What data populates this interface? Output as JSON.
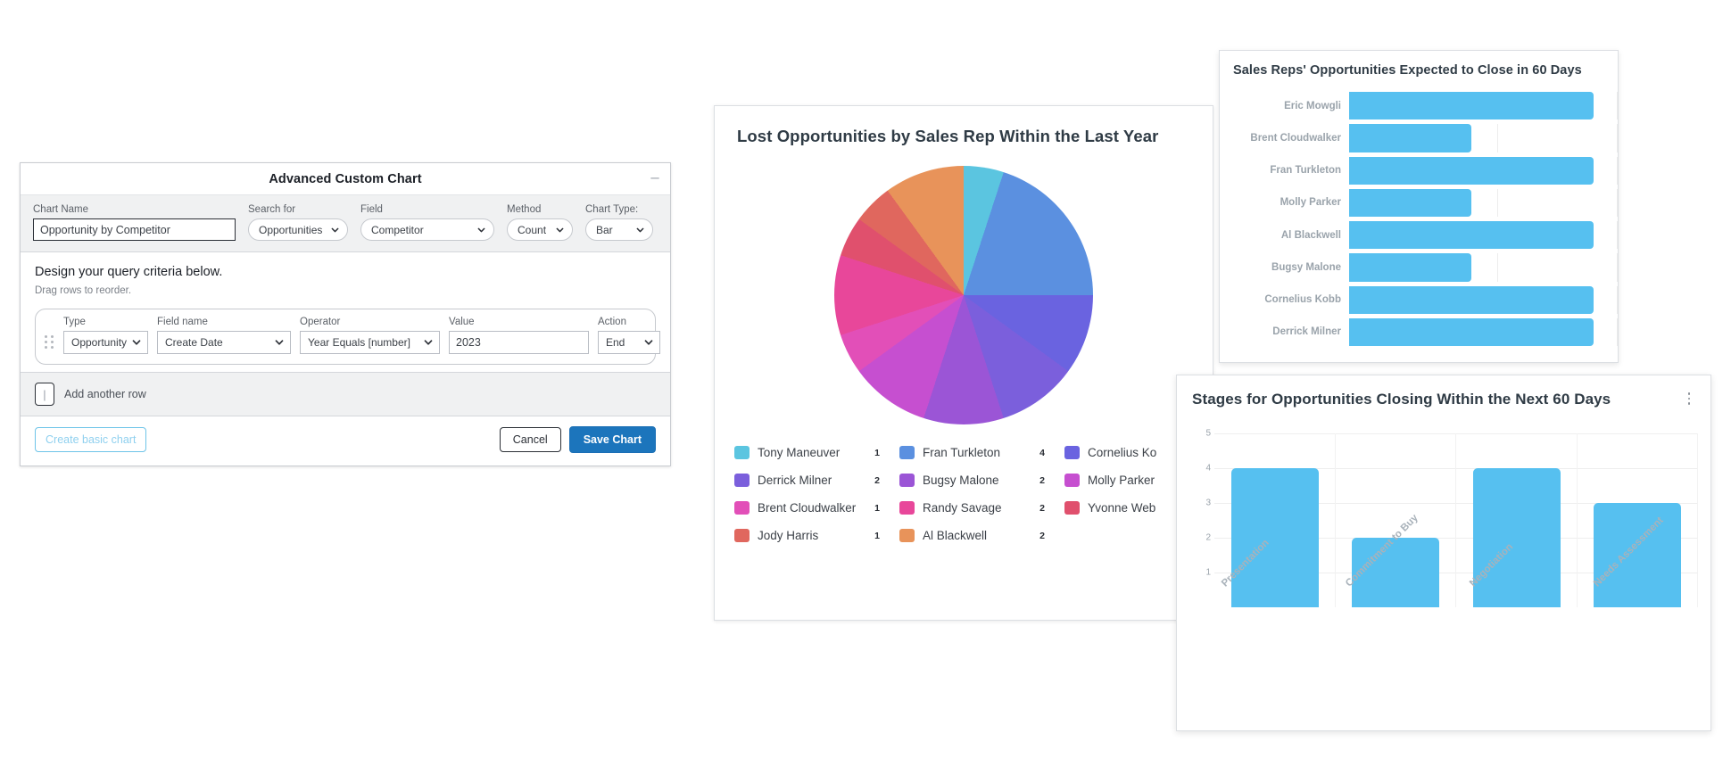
{
  "dialog": {
    "title": "Advanced Custom Chart",
    "collapse_icon": "chevron-collapse-icon",
    "chart_name_label": "Chart Name",
    "chart_name_value": "Opportunity by Competitor",
    "chart_name_placeholder": "Chart Name",
    "search_for_label": "Search for",
    "search_for_value": "Opportunities",
    "field_label": "Field",
    "field_value": "Competitor",
    "method_label": "Method",
    "method_value": "Count",
    "chart_type_label": "Chart Type:",
    "chart_type_value": "Bar",
    "criteria_heading": "Design your query criteria below.",
    "criteria_subheading": "Drag rows to reorder.",
    "criteria_columns": {
      "type": "Type",
      "field_name": "Field name",
      "operator": "Operator",
      "value": "Value",
      "action": "Action"
    },
    "criteria_row": {
      "type": "Opportunity",
      "field_name": "Create Date",
      "operator": "Year Equals [number]",
      "value": "2023",
      "action": "End"
    },
    "add_row_icon": "plus-icon",
    "add_row_label": "Add another row",
    "create_basic_label": "Create basic chart",
    "cancel_label": "Cancel",
    "save_label": "Save Chart"
  },
  "chart_data": [
    {
      "type": "pie",
      "title": "Lost Opportunities by Sales Rep Within the Last Year",
      "legend_position": "bottom",
      "categories": [
        "Tony Maneuver",
        "Fran Turkleton",
        "Cornelius Ko",
        "Derrick Milner",
        "Bugsy Malone",
        "Molly Parker",
        "Brent Cloudwalker",
        "Randy Savage",
        "Yvonne Web",
        "Jody Harris",
        "Al Blackwell"
      ],
      "values": [
        1,
        4,
        null,
        2,
        2,
        null,
        1,
        2,
        null,
        1,
        2
      ],
      "colors": [
        "#5bc5e0",
        "#5b90e0",
        "#6a63e0",
        "#7b5fdc",
        "#9b55d6",
        "#c64fd0",
        "#e24fb8",
        "#e8479a",
        "#e0506d",
        "#e06a5e",
        "#e8935a"
      ],
      "legend": [
        {
          "label": "Tony Maneuver",
          "value": "1",
          "color": "#5bc5e0"
        },
        {
          "label": "Fran Turkleton",
          "value": "4",
          "color": "#5b90e0"
        },
        {
          "label": "Cornelius Ko",
          "value": "",
          "color": "#6a63e0"
        },
        {
          "label": "Derrick Milner",
          "value": "2",
          "color": "#7b5fdc"
        },
        {
          "label": "Bugsy Malone",
          "value": "2",
          "color": "#9b55d6"
        },
        {
          "label": "Molly Parker",
          "value": "",
          "color": "#c64fd0"
        },
        {
          "label": "Brent Cloudwalker",
          "value": "1",
          "color": "#e24fb8"
        },
        {
          "label": "Randy Savage",
          "value": "2",
          "color": "#e8479a"
        },
        {
          "label": "Yvonne Web",
          "value": "",
          "color": "#e0506d"
        },
        {
          "label": "Jody Harris",
          "value": "1",
          "color": "#e0675e"
        },
        {
          "label": "Al Blackwell",
          "value": "2",
          "color": "#e8935a"
        }
      ]
    },
    {
      "type": "bar",
      "orientation": "horizontal",
      "title": "Sales Reps' Opportunities Expected to Close in 60 Days",
      "categories": [
        "Eric Mowgli",
        "Brent Cloudwalker",
        "Fran Turkleton",
        "Molly Parker",
        "Al Blackwell",
        "Bugsy Malone",
        "Cornelius Kobb",
        "Derrick Milner"
      ],
      "values": [
        2,
        1,
        2,
        1,
        2,
        1,
        2,
        2
      ],
      "xlim": [
        0,
        2.2
      ],
      "bar_color": "#56c0f0",
      "grid": true
    },
    {
      "type": "bar",
      "orientation": "vertical",
      "title": "Stages for Opportunities Closing Within the Next 60 Days",
      "categories": [
        "Presentation",
        "Commitment to Buy",
        "Negotiation",
        "Needs Assessment"
      ],
      "values": [
        4,
        2,
        4,
        3
      ],
      "yticks": [
        "5",
        "4",
        "3",
        "2",
        "1"
      ],
      "ylim": [
        0,
        5
      ],
      "bar_color": "#56c0f0",
      "grid": true,
      "menu_icon": "kebab-menu-icon"
    }
  ]
}
